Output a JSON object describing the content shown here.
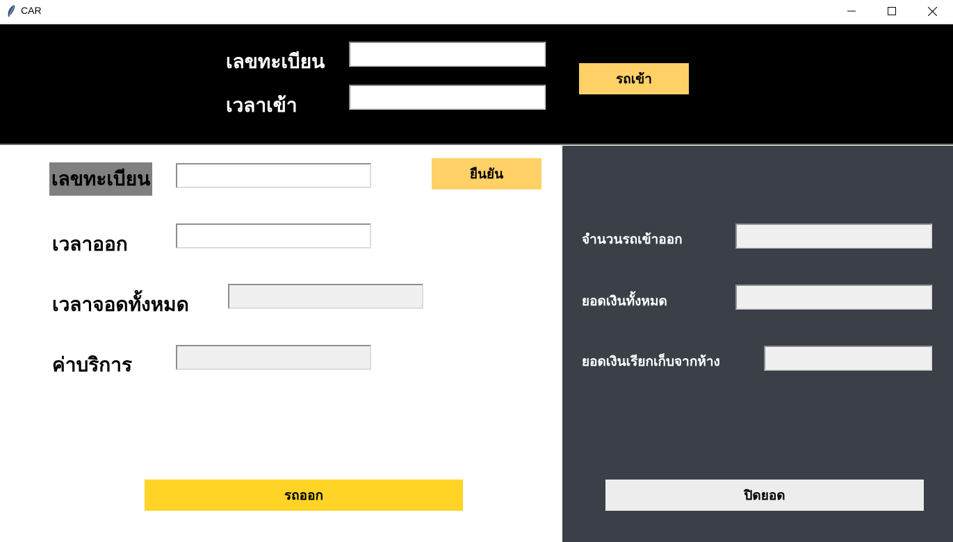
{
  "window": {
    "title": "CAR",
    "icon": "feather-icon"
  },
  "entry": {
    "plate_label": "เลขทะเบียน",
    "time_label": "เวลาเข้า",
    "plate_value": "",
    "time_value": "",
    "submit_label": "รถเข้า"
  },
  "exit": {
    "plate_label": "เลขทะเบียน",
    "plate_value": "",
    "confirm_label": "ยืนยัน",
    "time_out_label": "เวลาออก",
    "time_out_value": "",
    "total_time_label": "เวลาจอดทั้งหมด",
    "total_time_value": "",
    "fee_label": "ค่าบริการ",
    "fee_value": "",
    "submit_label": "รถออก"
  },
  "summary": {
    "count_label": "จำนวนรถเข้าออก",
    "count_value": "",
    "total_label": "ยอดเงินทั้งหมด",
    "total_value": "",
    "mall_label": "ยอดเงินเรียกเก็บจากห้าง",
    "mall_value": "",
    "close_label": "ปิดยอด"
  },
  "colors": {
    "top_bg": "#000000",
    "right_bg": "#3b3f47",
    "accent_yellow": "#ffd166",
    "exit_yellow": "#ffd426",
    "label_highlight": "#808080",
    "readonly_bg": "#f0f0f0"
  }
}
